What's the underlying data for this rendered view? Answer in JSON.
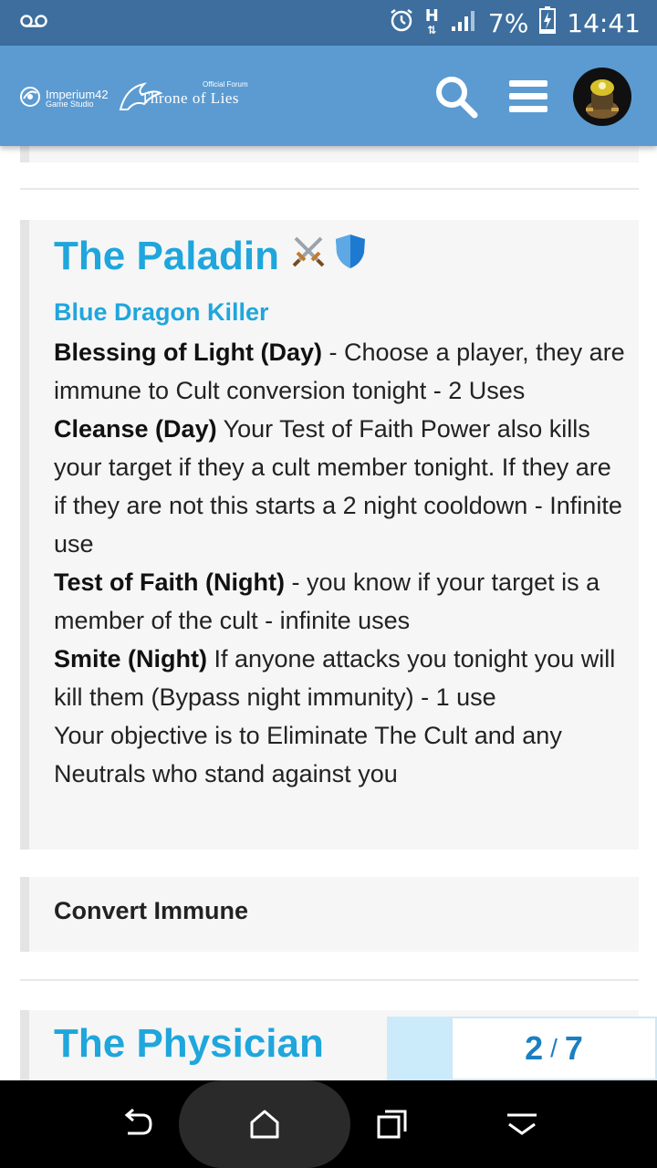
{
  "status_bar": {
    "battery": "7%",
    "time": "14:41",
    "network": "H",
    "icons": [
      "voicemail-icon",
      "alarm-icon",
      "network-h-icon",
      "signal-icon",
      "battery-charging-icon"
    ]
  },
  "header": {
    "logo_studio_name": "Imperium42",
    "logo_studio_sub": "Game Studio",
    "logo_forum_small": "Official Forum",
    "logo_forum_name": "Throne of Lies",
    "icons": [
      "search-icon",
      "menu-icon",
      "avatar"
    ]
  },
  "cards": [
    {
      "title": "The Paladin",
      "title_icons": [
        "crossed-swords-icon",
        "shield-icon"
      ],
      "subtitle": "Blue Dragon Killer",
      "abilities": [
        {
          "name": "Blessing of Light (Day)",
          "text": " - Choose a player, they are immune to Cult conversion tonight - 2 Uses"
        },
        {
          "name": "Cleanse (Day)",
          "text": " Your Test of Faith Power also kills your target if they a cult member tonight. If they are if they are not this starts a 2 night cooldown - Infinite use"
        },
        {
          "name": "Test of Faith (Night)",
          "text": " - you know if your target is a member of the cult - infinite uses"
        },
        {
          "name": "Smite (Night)",
          "text": " If anyone attacks you tonight you will kill them (Bypass night immunity) - 1 use"
        }
      ],
      "objective": "Your objective is to Eliminate The Cult and any Neutrals who stand against you"
    },
    {
      "label": "Convert Immune"
    },
    {
      "title": "The Physician"
    }
  ],
  "pager": {
    "current": "2",
    "separator": "/",
    "total": "7"
  },
  "colors": {
    "accent": "#1fa6dc",
    "header_bg": "#5b9bd2",
    "status_bg": "#3d6e9e"
  }
}
